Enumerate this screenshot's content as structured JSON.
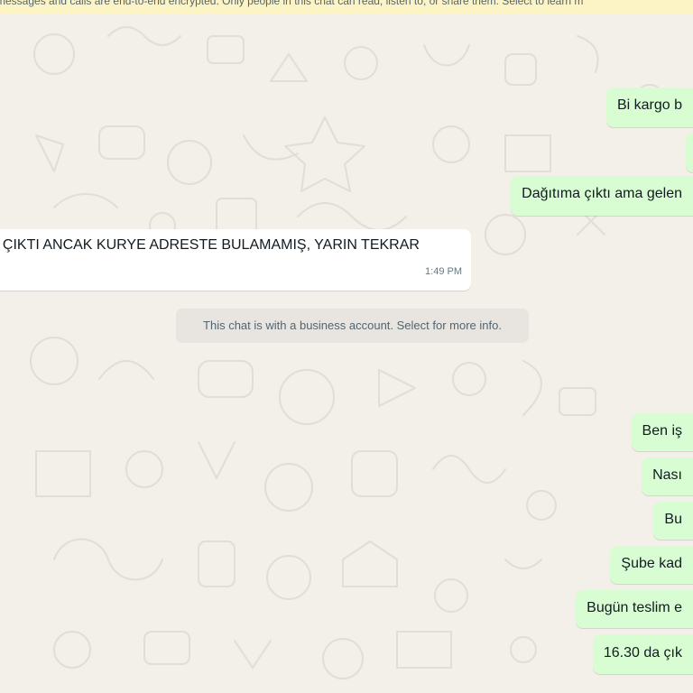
{
  "notice": {
    "encryption": "messages and calls are end-to-end encrypted. Only people in this chat can read, listen to, or share them. Select to learn m"
  },
  "messages": [
    {
      "text": "Bi kargo b"
    },
    {
      "text": ""
    },
    {
      "text": "Dağıtıma çıktı ama gelen"
    },
    {
      "text": ". ÇIKTI ANCAK  KURYE ADRESTE BULAMAMIŞ, YARIN TEKRAR",
      "time": "1:49 PM"
    },
    {
      "text": "Ben iş"
    },
    {
      "text": "Nası"
    },
    {
      "text": "Bu"
    },
    {
      "text": "Şube kad"
    },
    {
      "text": "Bugün teslim e"
    },
    {
      "text": "16.30 da çık"
    }
  ],
  "system": {
    "business_notice": "This chat is with a business account. Select for more info."
  },
  "colors": {
    "outgoing_bubble": "#d9fdd3",
    "incoming_bubble": "#ffffff",
    "chat_background": "#efeae2",
    "notice_background": "#fdf4c5"
  }
}
